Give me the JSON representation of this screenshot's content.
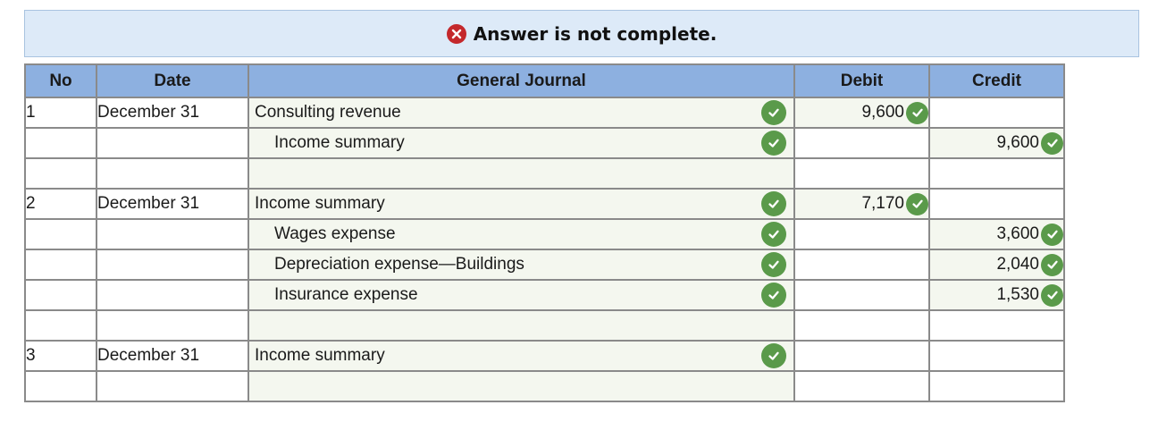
{
  "banner": {
    "message": "Answer is not complete.",
    "status_color": "#c4282c"
  },
  "table": {
    "headers": {
      "no": "No",
      "date": "Date",
      "general_journal": "General Journal",
      "debit": "Debit",
      "credit": "Credit"
    },
    "rows": [
      {
        "no": "1",
        "date": "December 31",
        "account": "Consulting revenue",
        "indent": false,
        "debit": "9,600",
        "credit": "",
        "account_correct": true
      },
      {
        "no": "",
        "date": "",
        "account": "Income summary",
        "indent": true,
        "debit": "",
        "credit": "9,600",
        "account_correct": true
      },
      {
        "no": "",
        "date": "",
        "account": "",
        "indent": false,
        "debit": "",
        "credit": "",
        "account_correct": false
      },
      {
        "no": "2",
        "date": "December 31",
        "account": "Income summary",
        "indent": false,
        "debit": "7,170",
        "credit": "",
        "account_correct": true
      },
      {
        "no": "",
        "date": "",
        "account": "Wages expense",
        "indent": true,
        "debit": "",
        "credit": "3,600",
        "account_correct": true
      },
      {
        "no": "",
        "date": "",
        "account": "Depreciation expense—Buildings",
        "indent": true,
        "debit": "",
        "credit": "2,040",
        "account_correct": true
      },
      {
        "no": "",
        "date": "",
        "account": "Insurance expense",
        "indent": true,
        "debit": "",
        "credit": "1,530",
        "account_correct": true
      },
      {
        "no": "",
        "date": "",
        "account": "",
        "indent": false,
        "debit": "",
        "credit": "",
        "account_correct": false
      },
      {
        "no": "3",
        "date": "December 31",
        "account": "Income summary",
        "indent": false,
        "debit": "",
        "credit": "",
        "account_correct": true
      },
      {
        "no": "",
        "date": "",
        "account": "",
        "indent": false,
        "debit": "",
        "credit": "",
        "account_correct": false
      }
    ]
  },
  "icons": {
    "correct": "check-circle-icon",
    "incorrect": "x-circle-icon"
  },
  "colors": {
    "header_bg": "#8db0e0",
    "banner_bg": "#ddeaf8",
    "check_green": "#5a9a4a"
  }
}
